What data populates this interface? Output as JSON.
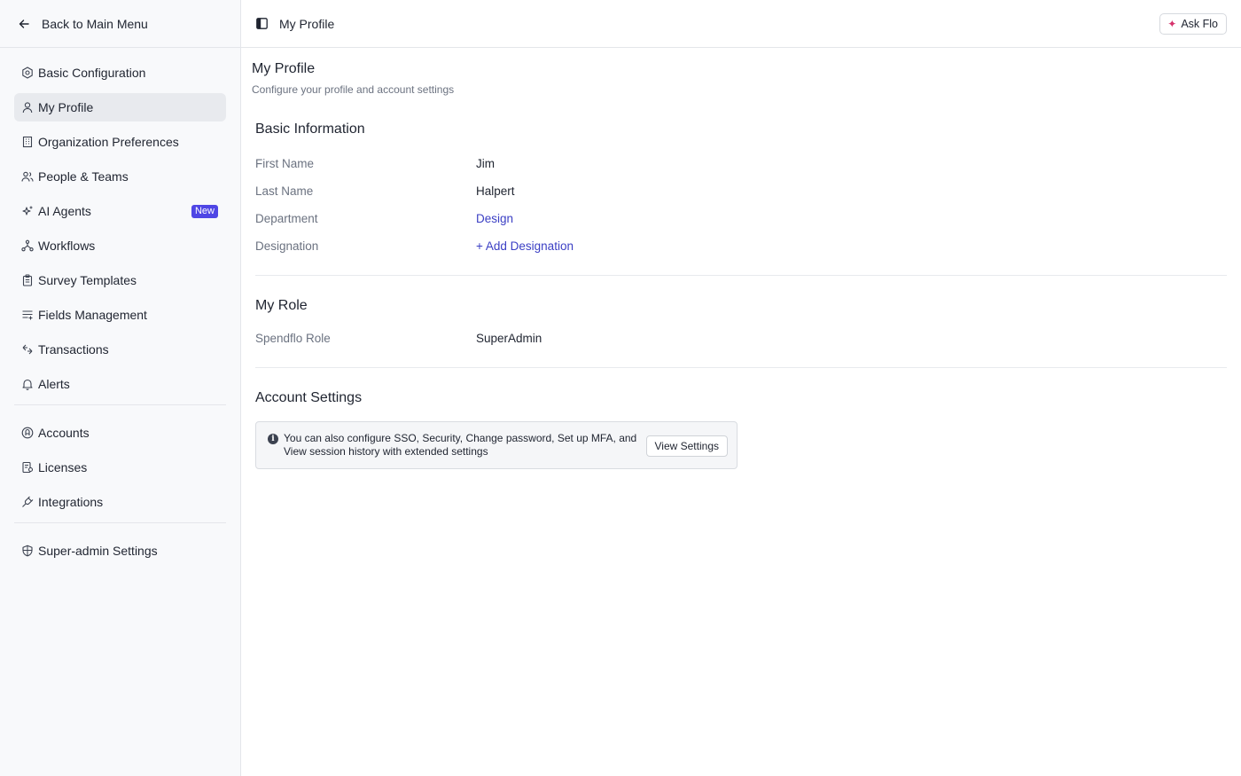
{
  "sidebar": {
    "back_label": "Back to Main Menu",
    "items": [
      {
        "label": "Basic Configuration",
        "icon": "hexagon-gear-icon"
      },
      {
        "label": "My Profile",
        "icon": "user-icon",
        "active": true
      },
      {
        "label": "Organization Preferences",
        "icon": "building-icon"
      },
      {
        "label": "People & Teams",
        "icon": "users-icon"
      },
      {
        "label": "AI Agents",
        "icon": "sparkles-icon",
        "badge": "New"
      },
      {
        "label": "Workflows",
        "icon": "workflow-icon"
      },
      {
        "label": "Survey Templates",
        "icon": "clipboard-icon"
      },
      {
        "label": "Fields Management",
        "icon": "list-plus-icon"
      },
      {
        "label": "Transactions",
        "icon": "arrows-exchange-icon"
      },
      {
        "label": "Alerts",
        "icon": "bell-icon"
      },
      {
        "label": "Accounts",
        "icon": "account-circle-icon"
      },
      {
        "label": "Licenses",
        "icon": "license-icon"
      },
      {
        "label": "Integrations",
        "icon": "plug-icon"
      },
      {
        "label": "Super-admin Settings",
        "icon": "shield-icon"
      }
    ]
  },
  "topbar": {
    "title": "My Profile",
    "ask_label": "Ask Flo"
  },
  "main": {
    "title": "My Profile",
    "subtitle": "Configure your profile and account settings",
    "basic_info": {
      "title": "Basic Information",
      "fields": [
        {
          "label": "First Name",
          "value": "Jim"
        },
        {
          "label": "Last Name",
          "value": "Halpert"
        },
        {
          "label": "Department",
          "value": "Design"
        },
        {
          "label": "Designation",
          "value": "+ Add Designation"
        }
      ]
    },
    "role": {
      "title": "My Role",
      "label": "Spendflo Role",
      "value": "SuperAdmin"
    },
    "account": {
      "title": "Account Settings",
      "info_text": "You can also configure SSO, Security, Change password, Set up MFA, and View session history with extended settings",
      "button_label": "View Settings"
    }
  },
  "colors": {
    "accent": "#4f46e5",
    "link": "#3b3fc4",
    "spark": "#d6336c"
  }
}
